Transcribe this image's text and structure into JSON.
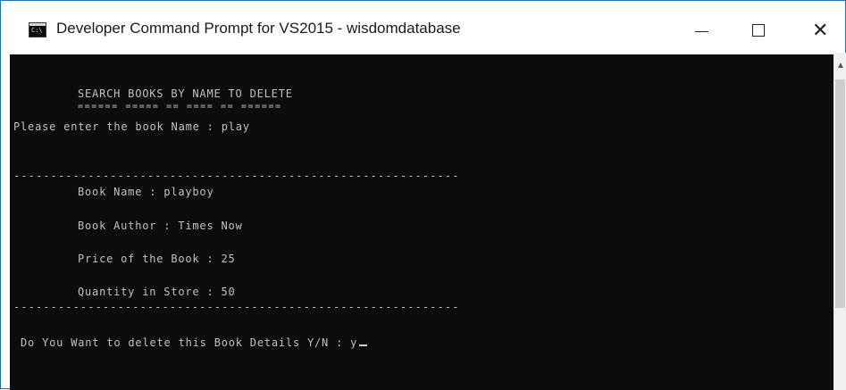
{
  "window": {
    "title": "Developer Command Prompt for VS2015 - wisdomdatabase",
    "icon_text": "C:\\",
    "controls": {
      "minimize": "minimize-icon",
      "maximize": "maximize-icon",
      "close": "close-icon"
    }
  },
  "console": {
    "heading": "SEARCH BOOKS BY NAME TO DELETE",
    "heading_underline": "====== ===== == ==== == ======",
    "prompt": "Please enter the book Name : play",
    "separator_top": "------------------------------------------------------------",
    "book_name": "Book Name : playboy",
    "book_author": "Book Author : Times Now",
    "book_price": "Price of the Book : 25",
    "book_quantity": "Quantity in Store : 50",
    "separator_bottom": "------------------------------------------------------------",
    "confirm": " Do You Want to delete this Book Details Y/N : y"
  },
  "colors": {
    "console_bg": "#0c0c0c",
    "console_text": "#c0c0c0",
    "window_border": "#1f6fb6"
  }
}
